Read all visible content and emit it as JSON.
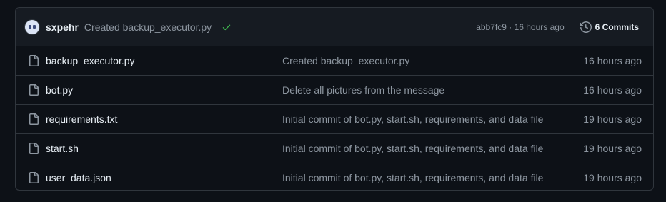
{
  "latest_commit": {
    "author": "sxpehr",
    "message": "Created backup_executor.py",
    "sha": "abb7fc9",
    "separator": " · ",
    "time": "16 hours ago",
    "commits_label": "6 Commits",
    "status": "success",
    "status_color": "#3fb950"
  },
  "files": [
    {
      "name": "backup_executor.py",
      "message": "Created backup_executor.py",
      "time": "16 hours ago",
      "icon": "file-icon"
    },
    {
      "name": "bot.py",
      "message": "Delete all pictures from the message",
      "time": "16 hours ago",
      "icon": "file-icon"
    },
    {
      "name": "requirements.txt",
      "message": "Initial commit of bot.py, start.sh, requirements, and data file",
      "time": "19 hours ago",
      "icon": "file-icon"
    },
    {
      "name": "start.sh",
      "message": "Initial commit of bot.py, start.sh, requirements, and data file",
      "time": "19 hours ago",
      "icon": "file-icon"
    },
    {
      "name": "user_data.json",
      "message": "Initial commit of bot.py, start.sh, requirements, and data file",
      "time": "19 hours ago",
      "icon": "file-icon"
    }
  ]
}
